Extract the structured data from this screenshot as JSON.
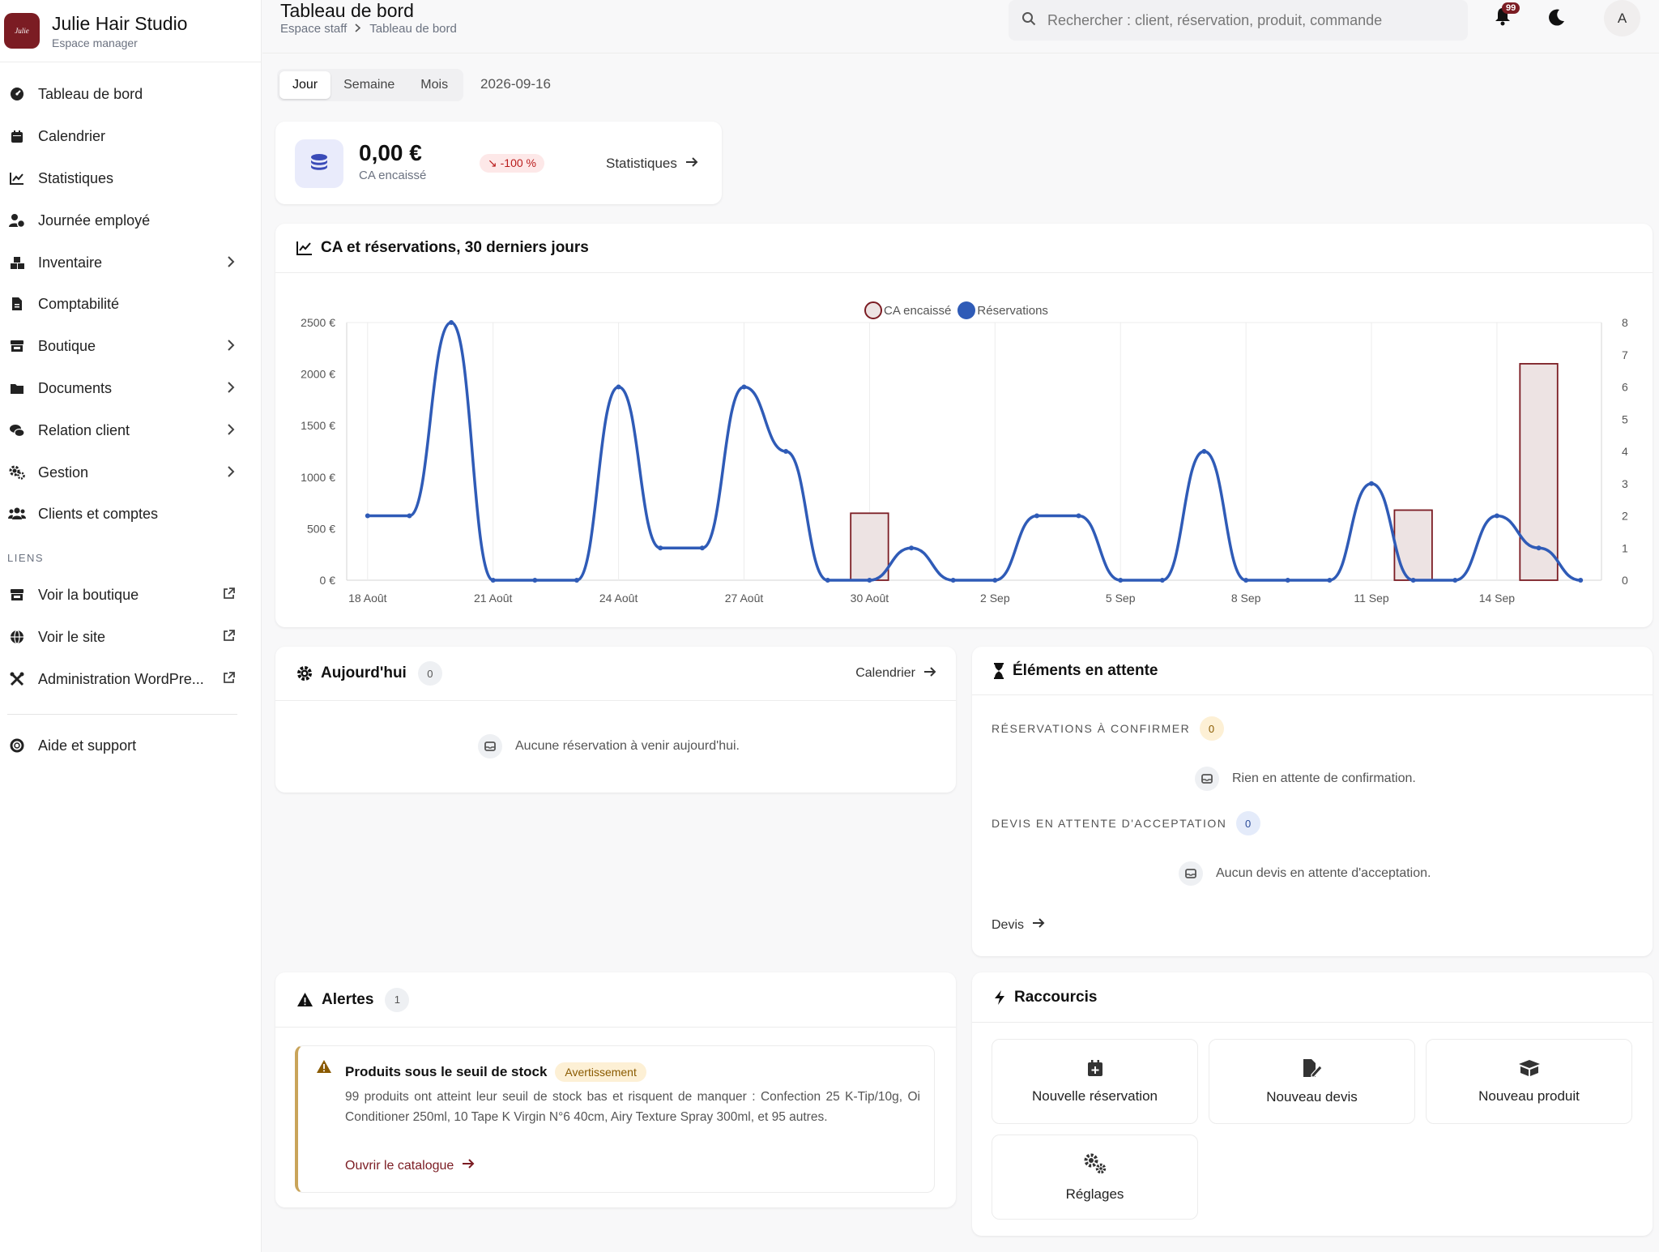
{
  "brand": {
    "logo_text": "Julie",
    "name": "Julie Hair Studio",
    "subtitle": "Espace manager"
  },
  "nav": {
    "items": [
      {
        "label": "Tableau de bord",
        "icon": "dashboard-icon"
      },
      {
        "label": "Calendrier",
        "icon": "calendar-icon"
      },
      {
        "label": "Statistiques",
        "icon": "chart-line-icon"
      },
      {
        "label": "Journée employé",
        "icon": "user-clock-icon"
      },
      {
        "label": "Inventaire",
        "icon": "boxes-icon"
      },
      {
        "label": "Comptabilité",
        "icon": "file-invoice-icon"
      },
      {
        "label": "Boutique",
        "icon": "store-icon"
      },
      {
        "label": "Documents",
        "icon": "folder-icon"
      },
      {
        "label": "Relation client",
        "icon": "comments-icon"
      },
      {
        "label": "Gestion",
        "icon": "gears-icon"
      },
      {
        "label": "Clients et comptes",
        "icon": "users-icon"
      }
    ],
    "links_section": "LIENS",
    "links": [
      {
        "label": "Voir la boutique"
      },
      {
        "label": "Voir le site"
      },
      {
        "label": "Administration WordPre..."
      }
    ],
    "help": "Aide et support"
  },
  "header": {
    "title": "Tableau de bord",
    "breadcrumb": [
      "Espace staff",
      "Tableau de bord"
    ],
    "search_placeholder": "Rechercher : client, réservation, produit, commande",
    "notifications_count": "99",
    "avatar_initial": "A"
  },
  "period": {
    "tabs": [
      "Jour",
      "Semaine",
      "Mois"
    ],
    "active": "Jour",
    "date": "2026-09-16"
  },
  "kpi": {
    "value": "0,00 €",
    "label": "CA encaissé",
    "trend": "-100 %",
    "link": "Statistiques"
  },
  "chart_card": {
    "title": "CA et réservations, 30 derniers jours"
  },
  "chart_data": {
    "type": "bar+line",
    "title": "CA et réservations, 30 derniers jours",
    "legend": [
      "CA encaissé",
      "Réservations"
    ],
    "legend_position": "top-center",
    "x": [
      "18 Août",
      "19 Août",
      "20 Août",
      "21 Août",
      "22 Août",
      "23 Août",
      "24 Août",
      "25 Août",
      "26 Août",
      "27 Août",
      "28 Août",
      "29 Août",
      "30 Août",
      "31 Août",
      "1 Sep",
      "2 Sep",
      "3 Sep",
      "4 Sep",
      "5 Sep",
      "6 Sep",
      "7 Sep",
      "8 Sep",
      "9 Sep",
      "10 Sep",
      "11 Sep",
      "12 Sep",
      "13 Sep",
      "14 Sep",
      "15 Sep",
      "16 Sep"
    ],
    "x_tick_labels": [
      "18 Août",
      "21 Août",
      "24 Août",
      "27 Août",
      "30 Août",
      "2 Sep",
      "5 Sep",
      "8 Sep",
      "11 Sep",
      "14 Sep"
    ],
    "series": [
      {
        "name": "CA encaissé",
        "type": "bar",
        "axis": "left",
        "color": "#7b1c23",
        "fill": "#ede3e3",
        "values": [
          0,
          0,
          0,
          0,
          0,
          0,
          0,
          0,
          0,
          0,
          0,
          0,
          650,
          0,
          0,
          0,
          0,
          0,
          0,
          0,
          0,
          0,
          0,
          0,
          0,
          680,
          0,
          0,
          2100,
          0
        ]
      },
      {
        "name": "Réservations",
        "type": "line",
        "axis": "right",
        "color": "#2f5bb7",
        "values": [
          2,
          2,
          8,
          0,
          0,
          0,
          6,
          1,
          1,
          6,
          4,
          0,
          0,
          1,
          0,
          0,
          2,
          2,
          0,
          0,
          4,
          0,
          0,
          0,
          3,
          0,
          0,
          2,
          1,
          0
        ]
      }
    ],
    "y_left": {
      "ticks": [
        "0 €",
        "500 €",
        "1000 €",
        "1500 €",
        "2000 €",
        "2500 €"
      ],
      "range": [
        0,
        2500
      ]
    },
    "y_right": {
      "ticks": [
        "0",
        "1",
        "2",
        "3",
        "4",
        "5",
        "6",
        "7",
        "8"
      ],
      "range": [
        0,
        8
      ]
    },
    "grid": true
  },
  "today": {
    "title": "Aujourd'hui",
    "count": "0",
    "link": "Calendrier",
    "empty": "Aucune réservation à venir aujourd'hui."
  },
  "pending": {
    "title": "Éléments en attente",
    "reservations_label": "RÉSERVATIONS À CONFIRMER",
    "reservations_count": "0",
    "reservations_empty": "Rien en attente de confirmation.",
    "quotes_label": "DEVIS EN ATTENTE D'ACCEPTATION",
    "quotes_count": "0",
    "quotes_empty": "Aucun devis en attente d'acceptation.",
    "link": "Devis"
  },
  "alerts": {
    "title": "Alertes",
    "count": "1",
    "item_title": "Produits sous le seuil de stock",
    "item_badge": "Avertissement",
    "item_text": "99 produits ont atteint leur seuil de stock bas et risquent de manquer : Confection 25 K-Tip/10g, Oi Conditioner 250ml, 10 Tape K Virgin N°6 40cm, Airy Texture Spray 300ml, et 95 autres.",
    "item_link": "Ouvrir le catalogue"
  },
  "shortcuts": {
    "title": "Raccourcis",
    "items": [
      "Nouvelle réservation",
      "Nouveau devis",
      "Nouveau produit",
      "Réglages"
    ]
  }
}
